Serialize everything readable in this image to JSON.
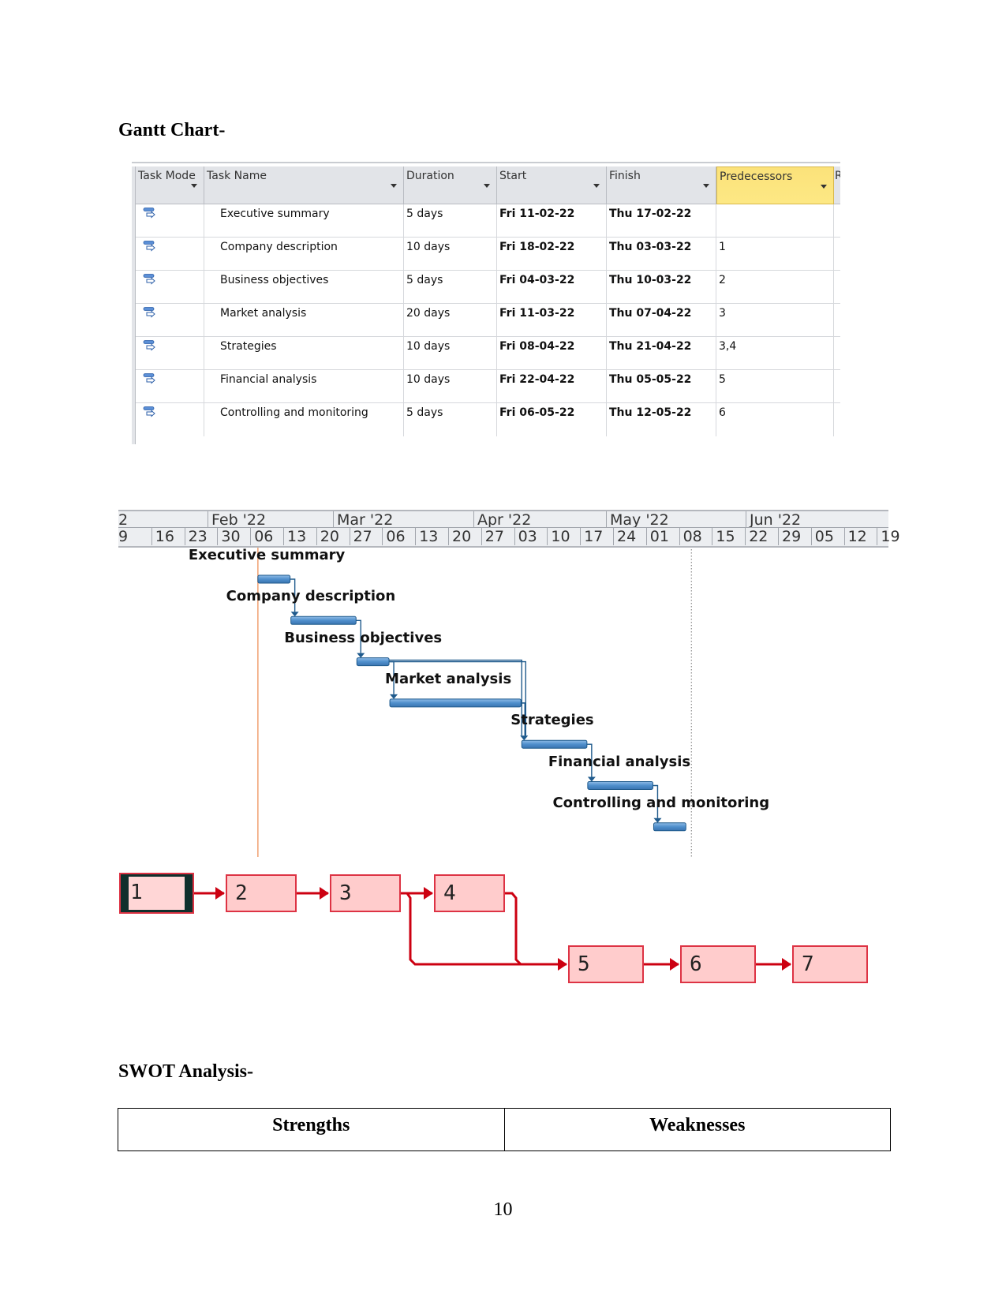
{
  "headings": {
    "gantt": "Gantt Chart-",
    "swot": "SWOT Analysis-"
  },
  "task_table": {
    "columns": [
      {
        "label": "Task Mode"
      },
      {
        "label": "Task Name"
      },
      {
        "label": "Duration"
      },
      {
        "label": "Start"
      },
      {
        "label": "Finish"
      },
      {
        "label": "Predecessors"
      },
      {
        "label": "R"
      }
    ],
    "mode_icon": "auto-scheduled-task-icon",
    "rows": [
      {
        "id": 1,
        "name": "Executive summary",
        "duration": "5 days",
        "start": "Fri 11-02-22",
        "finish": "Thu 17-02-22",
        "predecessors": ""
      },
      {
        "id": 2,
        "name": "Company description",
        "duration": "10 days",
        "start": "Fri 18-02-22",
        "finish": "Thu 03-03-22",
        "predecessors": "1"
      },
      {
        "id": 3,
        "name": "Business objectives",
        "duration": "5 days",
        "start": "Fri 04-03-22",
        "finish": "Thu 10-03-22",
        "predecessors": "2"
      },
      {
        "id": 4,
        "name": "Market analysis",
        "duration": "20 days",
        "start": "Fri 11-03-22",
        "finish": "Thu 07-04-22",
        "predecessors": "3"
      },
      {
        "id": 5,
        "name": "Strategies",
        "duration": "10 days",
        "start": "Fri 08-04-22",
        "finish": "Thu 21-04-22",
        "predecessors": "3,4"
      },
      {
        "id": 6,
        "name": "Financial analysis",
        "duration": "10 days",
        "start": "Fri 22-04-22",
        "finish": "Thu 05-05-22",
        "predecessors": "5"
      },
      {
        "id": 7,
        "name": "Controlling and monitoring",
        "duration": "5 days",
        "start": "Fri 06-05-22",
        "finish": "Thu 12-05-22",
        "predecessors": "6"
      }
    ]
  },
  "chart_data": {
    "type": "gantt",
    "months": [
      "2",
      "Feb '22",
      "Mar '22",
      "Apr '22",
      "May '22",
      "Jun '22"
    ],
    "weeks": [
      "9",
      "16",
      "23",
      "30",
      "06",
      "13",
      "20",
      "27",
      "06",
      "13",
      "20",
      "27",
      "03",
      "10",
      "17",
      "24",
      "01",
      "08",
      "15",
      "22",
      "29",
      "05",
      "12",
      "19"
    ],
    "today_marker": "2022-02-11",
    "status_marker": "2022-05-13",
    "tasks": [
      {
        "name": "Executive summary",
        "start": "2022-02-11",
        "end": "2022-02-18",
        "predecessors": []
      },
      {
        "name": "Company description",
        "start": "2022-02-18",
        "end": "2022-03-04",
        "predecessors": [
          1
        ]
      },
      {
        "name": "Business objectives",
        "start": "2022-03-04",
        "end": "2022-03-11",
        "predecessors": [
          2
        ]
      },
      {
        "name": "Market analysis",
        "start": "2022-03-11",
        "end": "2022-04-08",
        "predecessors": [
          3
        ]
      },
      {
        "name": "Strategies",
        "start": "2022-04-08",
        "end": "2022-04-22",
        "predecessors": [
          3,
          4
        ]
      },
      {
        "name": "Financial analysis",
        "start": "2022-04-22",
        "end": "2022-05-06",
        "predecessors": [
          5
        ]
      },
      {
        "name": "Controlling and monitoring",
        "start": "2022-05-06",
        "end": "2022-05-13",
        "predecessors": [
          6
        ]
      }
    ],
    "colors": {
      "bar": "#4f8fcc",
      "bar_border": "#1f5a8c",
      "link": "#1f5a8c",
      "today": "#f0a070"
    }
  },
  "network": {
    "nodes": [
      "1",
      "2",
      "3",
      "4",
      "5",
      "6",
      "7"
    ],
    "edges": [
      [
        1,
        2
      ],
      [
        2,
        3
      ],
      [
        3,
        4
      ],
      [
        3,
        5
      ],
      [
        4,
        5
      ],
      [
        5,
        6
      ],
      [
        6,
        7
      ]
    ],
    "colors": {
      "fill": "#ffcccc",
      "stroke": "#dd3344",
      "arrow": "#cc0011"
    }
  },
  "swot": {
    "columns": [
      "Strengths",
      "Weaknesses"
    ]
  },
  "page_number": "10"
}
